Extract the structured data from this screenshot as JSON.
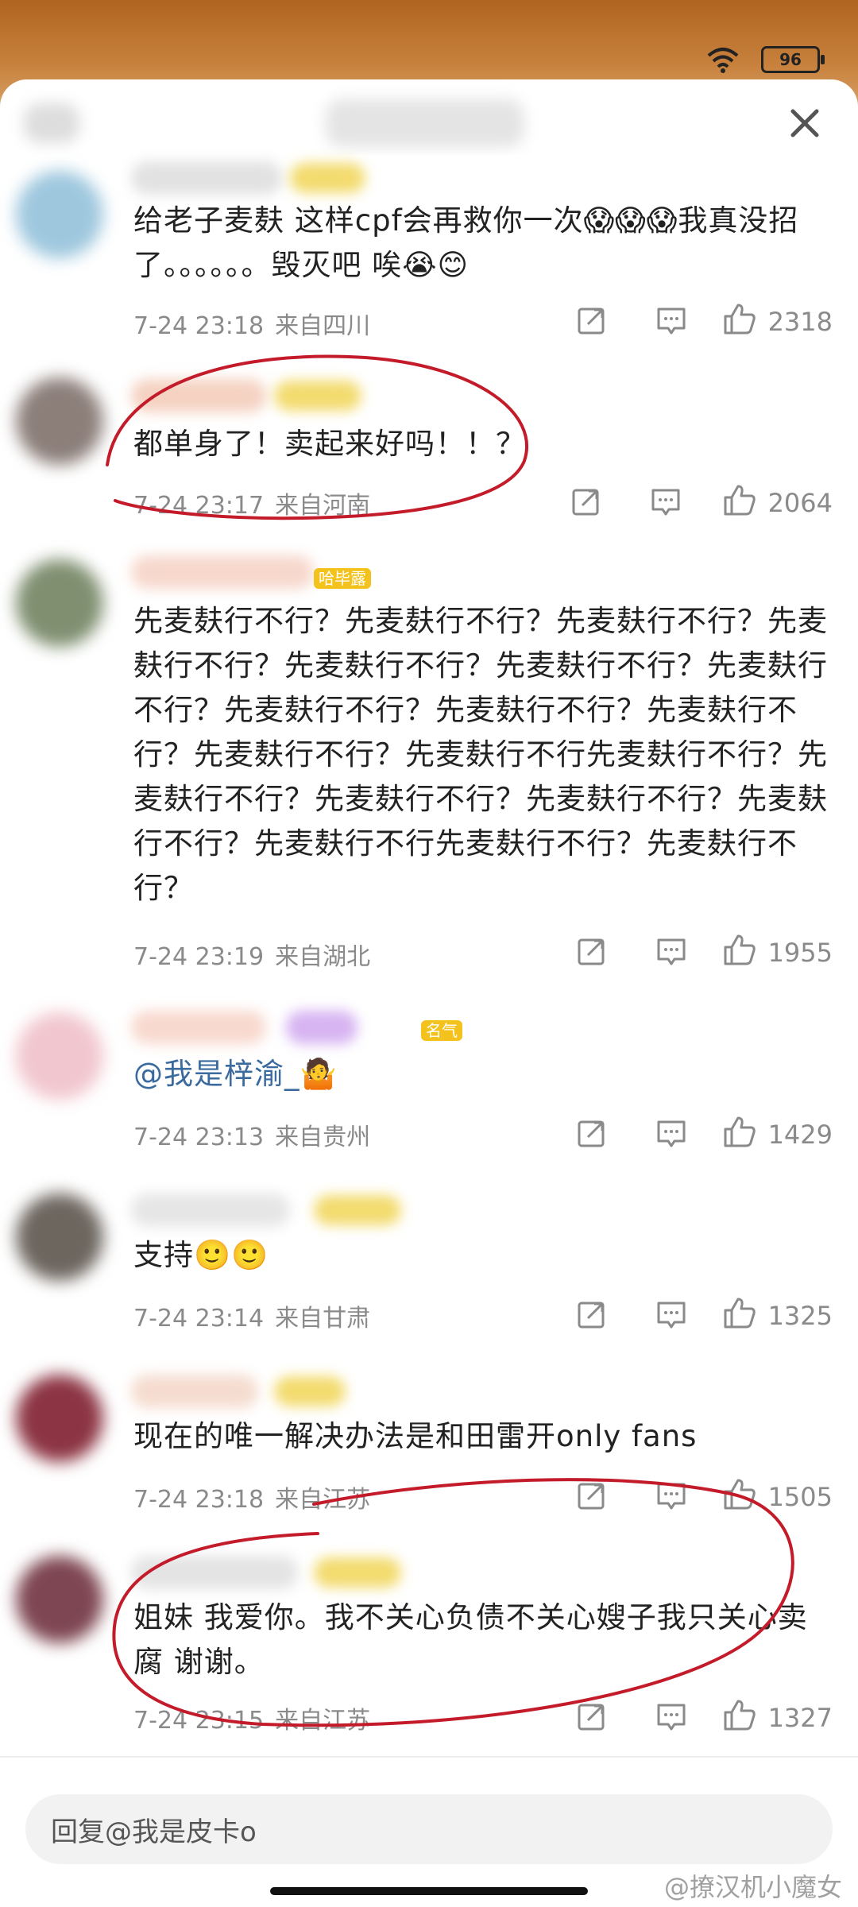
{
  "status_bar": {
    "battery": "96"
  },
  "reply_input": {
    "text": "回复@我是皮卡o"
  },
  "watermark": "@撩汉机小魔女",
  "badges": [
    "哈毕露",
    "名气"
  ],
  "comments": [
    {
      "text": "给老子麦麸 这样cpf会再救你一次😱😱😱我真没招了。。。。。。毁灭吧 唉😭😊",
      "time": "7-24 23:18",
      "location": "来自四川",
      "likes": "2318"
    },
    {
      "text": "都单身了！卖起来好吗！！？",
      "time": "7-24 23:17",
      "location": "来自河南",
      "likes": "2064"
    },
    {
      "text": "先麦麸行不行？先麦麸行不行？先麦麸行不行？先麦麸行不行？先麦麸行不行？先麦麸行不行？先麦麸行不行？先麦麸行不行？先麦麸行不行？先麦麸行不行？先麦麸行不行？先麦麸行不行先麦麸行不行？先麦麸行不行？先麦麸行不行？先麦麸行不行？先麦麸行不行？先麦麸行不行先麦麸行不行？先麦麸行不行？",
      "time": "7-24 23:19",
      "location": "来自湖北",
      "likes": "1955"
    },
    {
      "text": "@我是梓渝_🤷",
      "time": "7-24 23:13",
      "location": "来自贵州",
      "likes": "1429"
    },
    {
      "text": "支持🙂🙂",
      "time": "7-24 23:14",
      "location": "来自甘肃",
      "likes": "1325"
    },
    {
      "text": "现在的唯一解决办法是和田雷开only fans",
      "time": "7-24 23:18",
      "location": "来自江苏",
      "likes": "1505"
    },
    {
      "text": "姐妹 我爱你。我不关心负债不关心嫂子我只关心卖腐 谢谢。",
      "time": "7-24 23:15",
      "location": "来自江苏",
      "likes": "1327"
    }
  ],
  "icons": [
    "close-icon",
    "share-icon",
    "comment-icon",
    "like-icon",
    "wifi-icon"
  ]
}
